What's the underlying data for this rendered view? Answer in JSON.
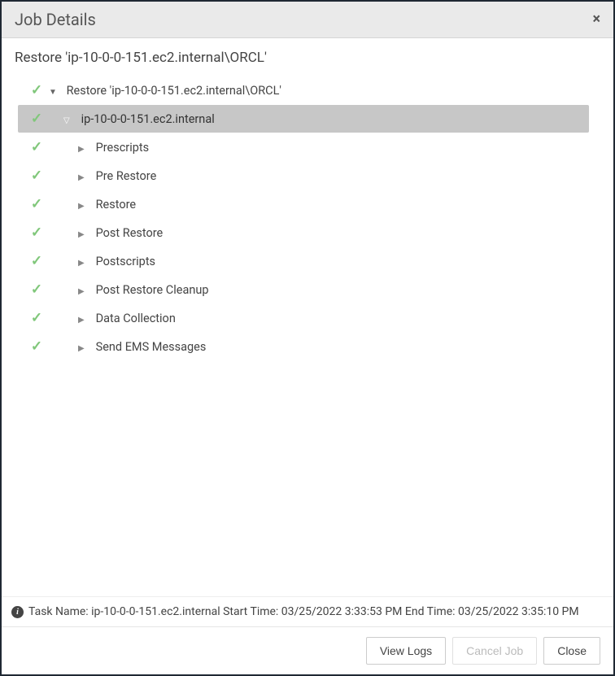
{
  "dialog": {
    "title": "Job Details",
    "close_label": "×"
  },
  "restore": {
    "title": "Restore 'ip-10-0-0-151.ec2.internal\\ORCL'"
  },
  "tree": {
    "root": {
      "label": "Restore 'ip-10-0-0-151.ec2.internal\\ORCL'"
    },
    "host": {
      "label": "ip-10-0-0-151.ec2.internal"
    },
    "steps": [
      {
        "label": "Prescripts"
      },
      {
        "label": "Pre Restore"
      },
      {
        "label": "Restore"
      },
      {
        "label": "Post Restore"
      },
      {
        "label": "Postscripts"
      },
      {
        "label": "Post Restore Cleanup"
      },
      {
        "label": "Data Collection"
      },
      {
        "label": "Send EMS Messages"
      }
    ]
  },
  "status": {
    "text": "Task Name: ip-10-0-0-151.ec2.internal Start Time: 03/25/2022 3:33:53 PM End Time: 03/25/2022 3:35:10 PM"
  },
  "footer": {
    "view_logs": "View Logs",
    "cancel_job": "Cancel Job",
    "close": "Close"
  }
}
